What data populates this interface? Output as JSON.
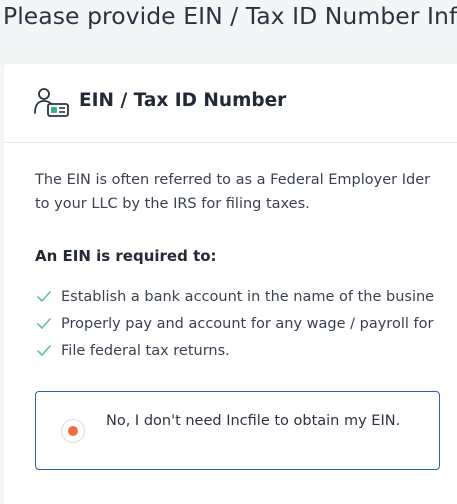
{
  "page": {
    "title": "Please provide EIN / Tax ID Number Inf"
  },
  "card": {
    "icon": "id-card-person-icon",
    "title": "EIN / Tax ID Number",
    "intro_line1": "The EIN is often referred to as a Federal Employer Ider",
    "intro_line2": "to your LLC by the IRS for filing taxes.",
    "requirements_heading": "An EIN is required to:",
    "requirements": [
      "Establish a bank account in the name of the busine",
      "Properly pay and account for any wage / payroll for",
      "File federal tax returns."
    ],
    "option": {
      "label": "No, I don't need Incfile to obtain my EIN.",
      "selected": true
    }
  },
  "colors": {
    "check": "#5ec29a",
    "option_border": "#2d62b8",
    "radio_selected": "#f26d3b",
    "icon_accent": "#3db08a"
  }
}
